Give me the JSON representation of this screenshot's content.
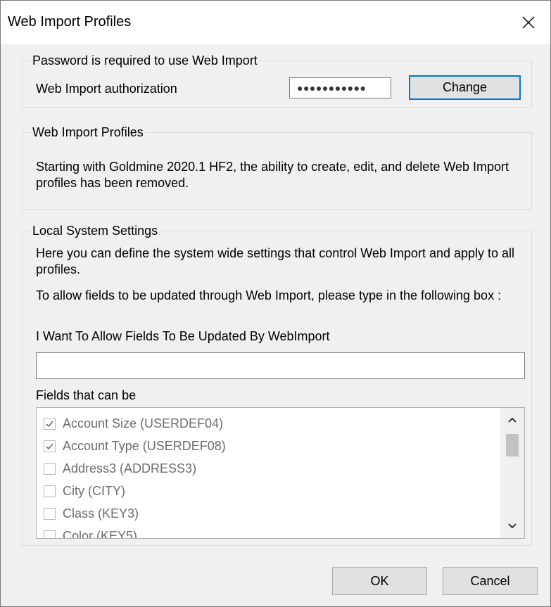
{
  "window": {
    "title": "Web Import Profiles"
  },
  "password_group": {
    "legend": "Password is required to use Web Import",
    "auth_label": "Web Import authorization",
    "password_value": "●●●●●●●●●●●",
    "change_button": "Change"
  },
  "profiles_group": {
    "legend": "Web Import Profiles",
    "message": "Starting with Goldmine 2020.1 HF2, the ability to create, edit, and delete Web Import profiles has been removed."
  },
  "local_settings": {
    "legend": "Local System Settings",
    "description": "Here you can define the system wide settings that control Web Import and apply to all profiles.",
    "instruction": "To allow fields to be updated through Web Import, please type in the following box :",
    "phrase": "I Want To Allow Fields To Be Updated By WebImport",
    "input_value": "",
    "fields_label": "Fields that can be",
    "fields": [
      {
        "label": "Account Size (USERDEF04)",
        "checked": true
      },
      {
        "label": "Account Type (USERDEF08)",
        "checked": true
      },
      {
        "label": "Address3 (ADDRESS3)",
        "checked": false
      },
      {
        "label": "City (CITY)",
        "checked": false
      },
      {
        "label": "Class (KEY3)",
        "checked": false
      },
      {
        "label": "Color (KEY5)",
        "checked": false
      }
    ]
  },
  "footer": {
    "ok_button": "OK",
    "cancel_button": "Cancel"
  },
  "icons": [
    "close-icon",
    "checkmark-icon",
    "chevron-up-icon",
    "chevron-down-icon"
  ],
  "colors": {
    "accent": "#0078d7",
    "background": "#f0f0f0",
    "disabled_text": "#6d6d6d"
  }
}
